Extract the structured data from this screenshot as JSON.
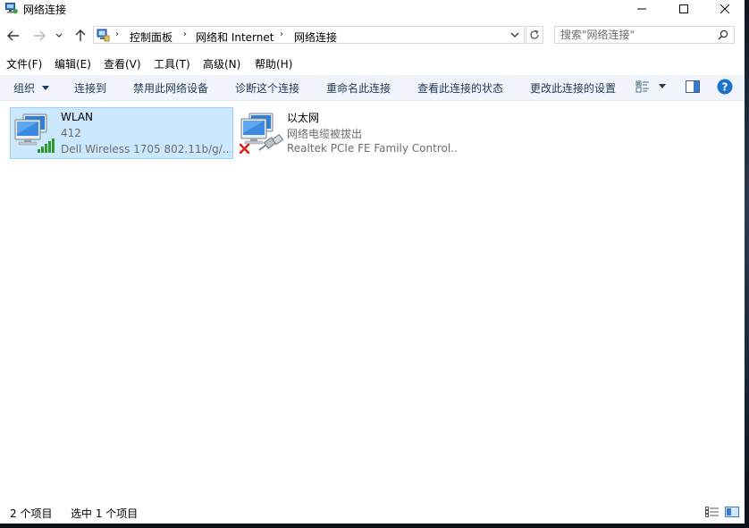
{
  "window": {
    "title": "网络连接"
  },
  "address": {
    "crumbs": [
      "控制面板",
      "网络和 Internet",
      "网络连接"
    ]
  },
  "search": {
    "placeholder": "搜索\"网络连接\""
  },
  "menu": {
    "items": [
      "文件(F)",
      "编辑(E)",
      "查看(V)",
      "工具(T)",
      "高级(N)",
      "帮助(H)"
    ]
  },
  "commands": {
    "organize": "组织",
    "connect_to": "连接到",
    "disable": "禁用此网络设备",
    "diagnose": "诊断这个连接",
    "rename": "重命名此连接",
    "view_status": "查看此连接的状态",
    "change_settings": "更改此连接的设置"
  },
  "connections": [
    {
      "name": "WLAN",
      "status": "412",
      "device": "Dell Wireless 1705 802.11b/g/...",
      "selected": true,
      "icon": "wireless-network-icon"
    },
    {
      "name": "以太网",
      "status": "网络电缆被拔出",
      "device": "Realtek PCIe FE Family Control...",
      "selected": false,
      "icon": "ethernet-disconnected-icon"
    }
  ],
  "status_bar": {
    "item_count": "2 个项目",
    "selected_count": "选中 1 个项目"
  },
  "colors": {
    "selection_bg": "#cce8ff",
    "selection_border": "#99d1ff",
    "command_text": "#1e395b",
    "help_blue": "#1a73c9"
  }
}
